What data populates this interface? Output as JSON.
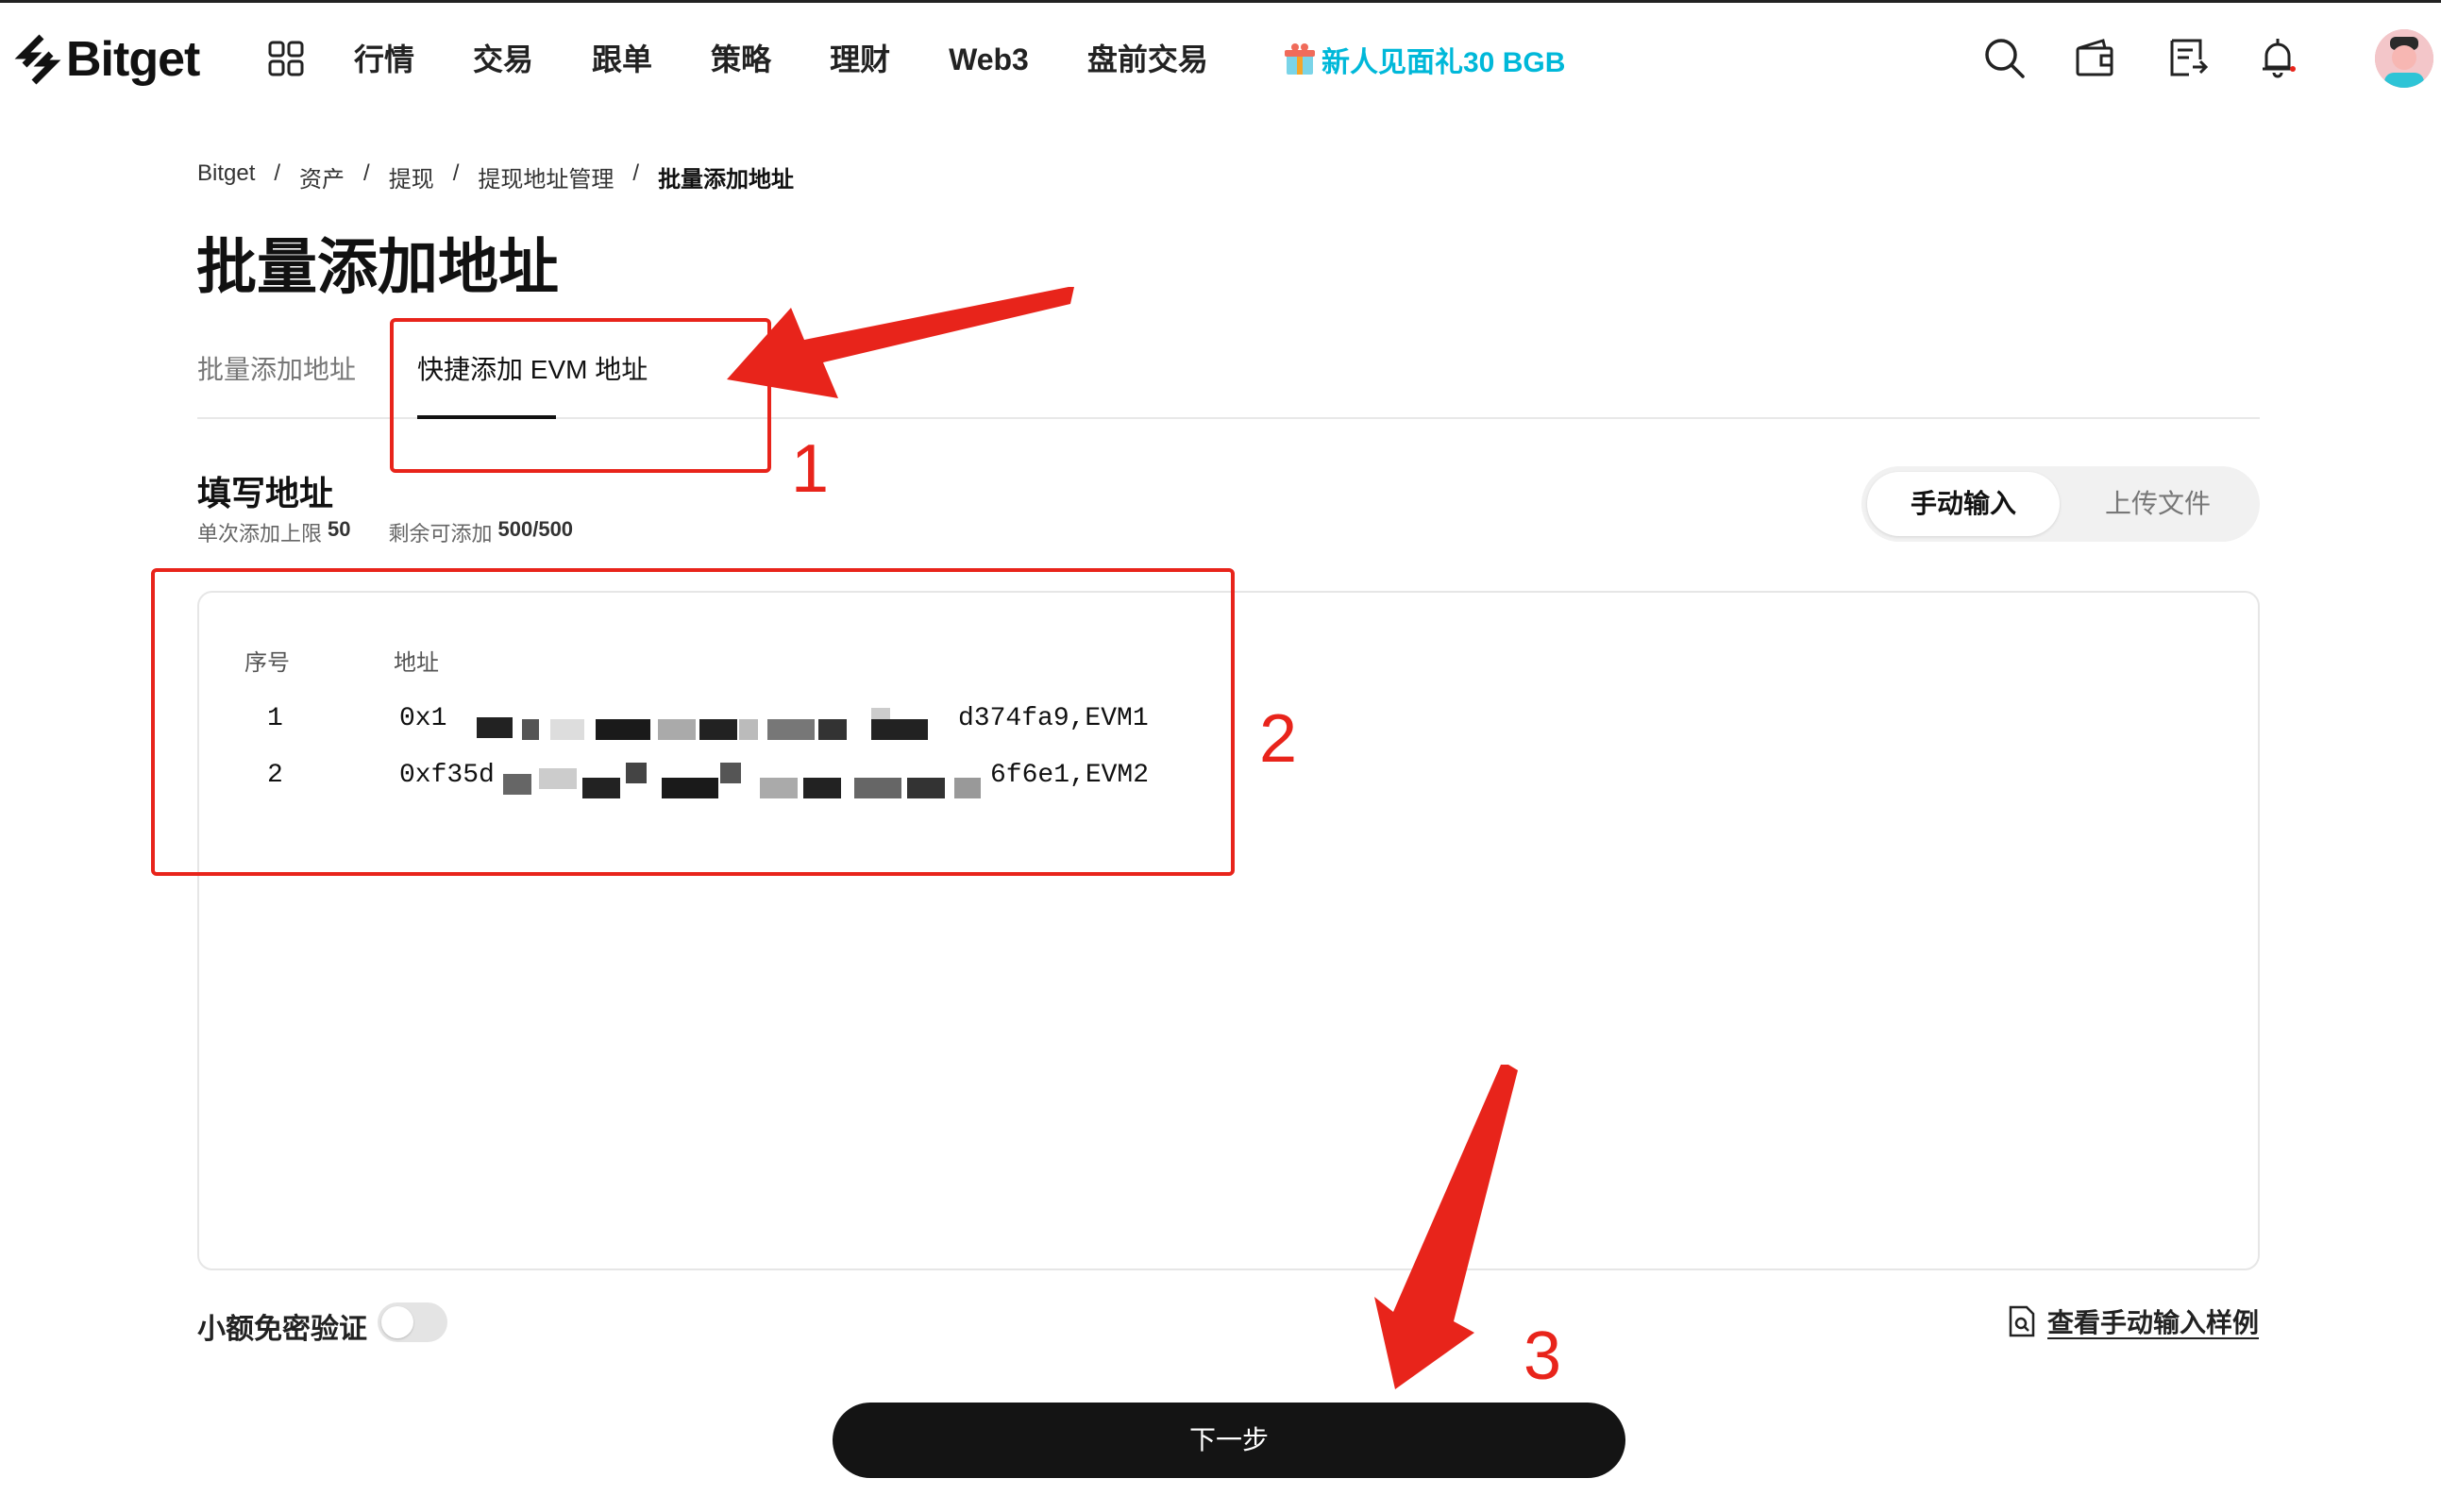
{
  "header": {
    "logo_text": "Bitget",
    "nav": [
      "行情",
      "交易",
      "跟单",
      "策略",
      "理财",
      "Web3",
      "盘前交易"
    ],
    "promo": "新人见面礼30 BGB"
  },
  "breadcrumb": [
    "Bitget",
    "资产",
    "提现",
    "提现地址管理",
    "批量添加地址"
  ],
  "page_title": "批量添加地址",
  "tabs": [
    "批量添加地址",
    "快捷添加 EVM 地址"
  ],
  "section": {
    "title": "填写地址",
    "limit_label": "单次添加上限",
    "limit_value": "50",
    "remaining_label": "剩余可添加",
    "remaining_value": "500/500"
  },
  "input_mode": {
    "manual": "手动输入",
    "upload": "上传文件",
    "selected": "手动输入"
  },
  "address_table": {
    "col_index": "序号",
    "col_address": "地址",
    "rows": [
      {
        "index": "1",
        "prefix": "0x1",
        "suffix": "d374fa9,EVM1"
      },
      {
        "index": "2",
        "prefix": "0xf35d",
        "suffix": "6f6e1,EVM2"
      }
    ]
  },
  "footer": {
    "small_amount_label": "小额免密验证",
    "small_amount_enabled": false,
    "example_link": "查看手动输入样例",
    "next_button": "下一步"
  },
  "annotations": [
    "1",
    "2",
    "3"
  ],
  "colors": {
    "accent": "#e8241b",
    "promo": "#00b8d9",
    "button": "#141414"
  }
}
